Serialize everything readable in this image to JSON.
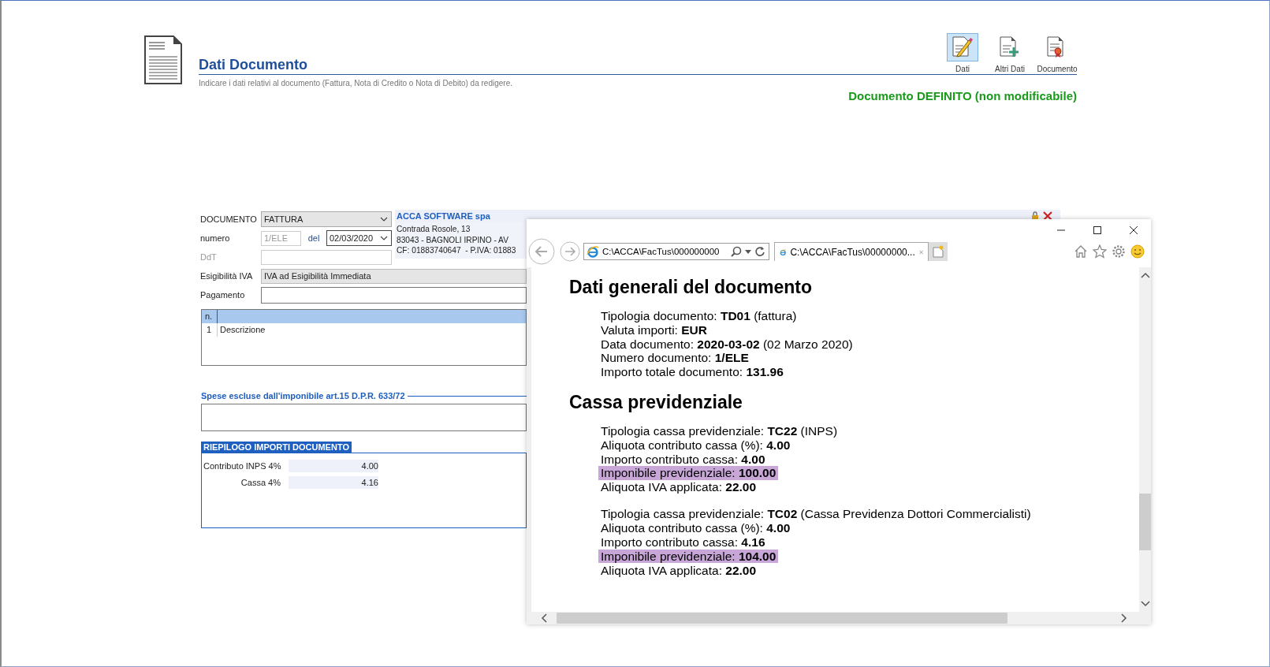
{
  "page_header": {
    "title": "Dati Documento",
    "subtitle": "Indicare i dati relativi al documento (Fattura, Nota di Credito o Nota di Debito) da redigere.",
    "status": "Documento DEFINITO (non modificabile)"
  },
  "tools": [
    {
      "kind": "edit",
      "label": "Dati",
      "selected": true
    },
    {
      "kind": "add",
      "label": "Altri Dati",
      "selected": false
    },
    {
      "kind": "certificate",
      "label": "Documento",
      "selected": false
    }
  ],
  "form": {
    "documento": {
      "label": "DOCUMENTO",
      "value": "FATTURA"
    },
    "numero": {
      "label": "numero",
      "value": "1/ELE",
      "disabled": true
    },
    "date": {
      "label": "del",
      "value": "02/03/2020"
    },
    "ddt": {
      "label": "DdT",
      "disabled": true
    },
    "esigibilita": {
      "label": "Esigibilità IVA",
      "value": "IVA ad Esigibilità Immediata"
    },
    "pagamento": {
      "label": "Pagamento"
    }
  },
  "company": {
    "name": "ACCA SOFTWARE spa",
    "lines": [
      "Contrada Rosole, 13",
      "83043 - BAGNOLI IRPINO - AV",
      "CF: 01883740647  - P.IVA: 01883"
    ]
  },
  "lines_table": {
    "columns": [
      "n."
    ],
    "rows": [
      {
        "n": "1",
        "description": "Descrizione"
      }
    ]
  },
  "spese": {
    "title": "Spese escluse dall'imponibile art.15 D.P.R. 633/72"
  },
  "riepilogo": {
    "title": "RIEPILOGO IMPORTI DOCUMENTO",
    "rows": [
      {
        "label": "Contributo INPS 4%",
        "value": "4.00"
      },
      {
        "label": "Cassa 4%",
        "value": "4.16"
      }
    ]
  },
  "browser": {
    "address": "C:\\ACCA\\FacTus\\000000000",
    "tab": {
      "title": "C:\\ACCA\\FacTus\\00000000..."
    },
    "sections": [
      {
        "heading": "Dati generali del documento",
        "groups": [
          {
            "lines": [
              {
                "text": "Tipologia documento: **TD01** (fattura)",
                "highlighted": false
              },
              {
                "text": "Valuta importi: **EUR**",
                "highlighted": false
              },
              {
                "text": "Data documento: **2020-03-02** (02 Marzo 2020)",
                "highlighted": false
              },
              {
                "text": "Numero documento: **1/ELE**",
                "highlighted": false
              },
              {
                "text": "Importo totale documento: **131.96**",
                "highlighted": false
              }
            ]
          }
        ]
      },
      {
        "heading": "Cassa previdenziale",
        "groups": [
          {
            "lines": [
              {
                "text": "Tipologia cassa previdenziale: **TC22** (INPS)",
                "highlighted": false
              },
              {
                "text": "Aliquota contributo cassa (%): **4.00**",
                "highlighted": false
              },
              {
                "text": "Importo contributo cassa: **4.00**",
                "highlighted": false
              },
              {
                "text": "Imponibile previdenziale: **100.00**",
                "highlighted": true
              },
              {
                "text": "Aliquota IVA applicata: **22.00**",
                "highlighted": false
              }
            ]
          },
          {
            "lines": [
              {
                "text": "Tipologia cassa previdenziale: **TC02** (Cassa Previdenza Dottori Commercialisti)",
                "highlighted": false
              },
              {
                "text": "Aliquota contributo cassa (%): **4.00**",
                "highlighted": false
              },
              {
                "text": "Importo contributo cassa: **4.16**",
                "highlighted": false
              },
              {
                "text": "Imponibile previdenziale: **104.00**",
                "highlighted": true
              },
              {
                "text": "Aliquota IVA applicata: **22.00**",
                "highlighted": false
              }
            ]
          }
        ]
      }
    ]
  }
}
